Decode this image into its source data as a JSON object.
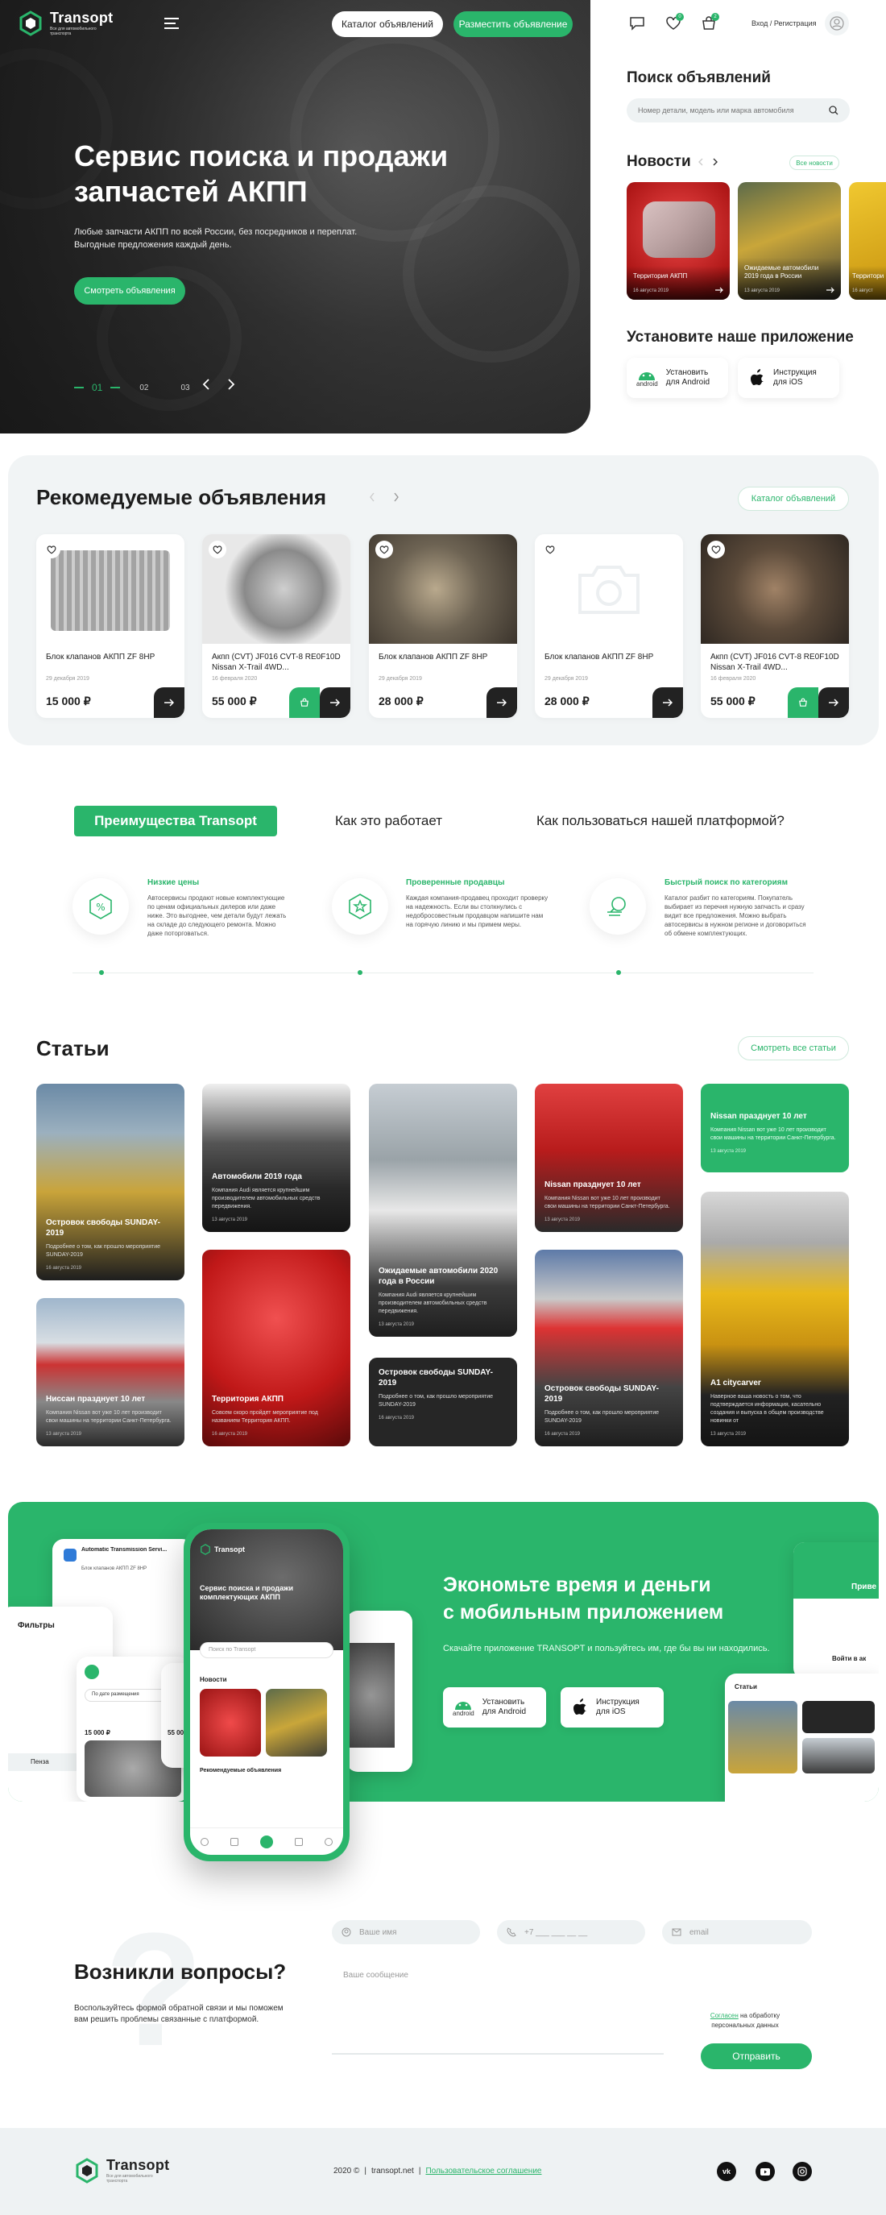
{
  "brand": {
    "name": "Transopt",
    "tagline": "Все для автомобильного транспорта"
  },
  "header": {
    "catalog_btn": "Каталог объявлений",
    "post_btn": "Разместить объявление",
    "cart_count": "2",
    "fav_count": "0",
    "login": "Вход / Регистрация"
  },
  "hero": {
    "title_line1": "Сервис поиска и продажи",
    "title_line2": "запчастей АКПП",
    "subtitle_line1": "Любые запчасти АКПП по всей России, без посредников и переплат.",
    "subtitle_line2": "Выгодные предложения каждый день.",
    "cta": "Смотреть объявления",
    "slides": [
      "01",
      "02",
      "03"
    ]
  },
  "search": {
    "title": "Поиск объявлений",
    "placeholder": "Номер детали, модель или марка автомобиля"
  },
  "news": {
    "title": "Новости",
    "all": "Все новости",
    "items": [
      {
        "title": "Территория АКПП",
        "date": "16 августа 2019"
      },
      {
        "title": "Ожидаемые автомобили 2019 года в России",
        "date": "13 августа 2019"
      },
      {
        "title": "Территори",
        "date": "16 август"
      }
    ]
  },
  "app": {
    "title": "Установите наше приложение",
    "android_line1": "Установить",
    "android_line2": "для Android",
    "android_badge": "android",
    "ios_line1": "Инструкция",
    "ios_line2": "для iOS"
  },
  "recommended": {
    "title": "Рекомедуемые объявления",
    "catalog": "Каталог объявлений",
    "items": [
      {
        "name": "Блок клапанов АКПП ZF 8HP",
        "date": "29 декабря 2019",
        "price": "15 000 ₽"
      },
      {
        "name": "Акпп (CVT) JF016 CVT-8 RE0F10D Nissan X-Trail 4WD...",
        "date": "16 февраля 2020",
        "price": "55 000 ₽"
      },
      {
        "name": "Блок клапанов АКПП ZF 8HP",
        "date": "29 декабря 2019",
        "price": "28 000 ₽"
      },
      {
        "name": "Блок клапанов АКПП ZF 8HP",
        "date": "29 декабря 2019",
        "price": "28 000 ₽"
      },
      {
        "name": "Акпп (CVT) JF016 CVT-8 RE0F10D Nissan X-Trail 4WD...",
        "date": "16 февраля 2020",
        "price": "55 000 ₽"
      }
    ]
  },
  "advantages": {
    "tabs": [
      "Преимущества Transopt",
      "Как это работает",
      "Как пользоваться нашей платформой?"
    ],
    "items": [
      {
        "title": "Низкие цены",
        "text": "Автосервисы продают новые комплектующие по ценам официальных дилеров или даже ниже. Это выгоднее, чем детали будут лежать на складе до следующего ремонта. Можно даже поторговаться."
      },
      {
        "title": "Проверенные продавцы",
        "text": "Каждая компания-продавец проходит проверку на надежность. Если вы столкнулись с недобросовестным продавцом напишите нам на горячую линию и мы примем меры."
      },
      {
        "title": "Быстрый поиск по категориям",
        "text": "Каталог разбит по категориям. Покупатель выбирает из перечня нужную запчасть и сразу видит все предложения. Можно выбрать автосервисы в нужном регионе и договориться об обмене комплектующих."
      }
    ]
  },
  "articles": {
    "title": "Статьи",
    "all": "Смотреть все статьи",
    "items": [
      {
        "title": "Островок свободы SUNDAY-2019",
        "text": "Подробнее о том, как прошло мероприятие SUNDAY-2019",
        "date": "16 августа 2019"
      },
      {
        "title": "Ниссан празднует 10 лет",
        "text": "Компания Nissan вот уже 10 лет производит свои машины на территории Санкт-Петербурга.",
        "date": "13 августа 2019"
      },
      {
        "title": "Автомобили 2019 года",
        "text": "Компания Audi является крупнейшим производителем автомобильных средств передвижения.",
        "date": "13 августа 2019"
      },
      {
        "title": "Территория АКПП",
        "text": "Совсем скоро пройдет мероприятие под названием Территория АКПП.",
        "date": "16 августа 2019"
      },
      {
        "title": "Ожидаемые автомобили 2020 года в России",
        "text": "Компания Audi является крупнейшим производителем автомобильных средств передвижения.",
        "date": "13 августа 2019"
      },
      {
        "title": "Островок свободы SUNDAY-2019",
        "text": "Подробнее о том, как прошло мероприятие SUNDAY-2019",
        "date": "16 августа 2019"
      },
      {
        "title": "Nissan празднует 10 лет",
        "text": "Компания Nissan вот уже 10 лет производит свои машины на территории Санкт-Петербурга.",
        "date": "13 августа 2019"
      },
      {
        "title": "Островок свободы SUNDAY-2019",
        "text": "Подробнее о том, как прошло мероприятие SUNDAY-2019",
        "date": "16 августа 2019"
      },
      {
        "title": "Nissan празднует 10 лет",
        "text": "Компания Nissan вот уже 10 лет производит свои машины на территории Санкт-Петербурга.",
        "date": "13 августа 2019"
      },
      {
        "title": "A1 citycarver",
        "text": "Наверное ваша новость о том, что подтверждается информация, касательно создания и выпуска в общем производстве новинки от",
        "date": "13 августа 2019"
      }
    ]
  },
  "promo": {
    "title_line1": "Экономьте время и деньги",
    "title_line2": "с мобильным приложением",
    "text": "Скачайте приложение TRANSOPT и пользуйтесь им, где бы вы ни находились.",
    "phone_title": "Сервис поиска и продажи комплектующих АКПП",
    "phone_search": "Поиск по Transopt",
    "phone_news": "Новости",
    "phone_rec": "Рекомендуемые объявления",
    "filters": "Фильтры",
    "filters_sort": "По дате размещения",
    "filters_price": "15 000 ₽",
    "filters_price2": "55 00",
    "filters_region": "Пенза",
    "listing": "Automatic Transmission Servi...",
    "listing_item": "Блок клапанов АКПП ZF 8HP",
    "articles_label": "Статьи",
    "right_hello": "Приве",
    "right_login": "Войти в ак"
  },
  "questions": {
    "title": "Возникли вопросы?",
    "text_line1": "Воспользуйтесь формой обратной связи и мы поможем",
    "text_line2": "вам решить проблемы связанные с платформой.",
    "name_ph": "Ваше имя",
    "phone_ph": "+7 ___ ___ __ __",
    "email_ph": "email",
    "message_ph": "Ваше сообщение",
    "consent_link": "Согласен",
    "consent_text": "на обработку персональных данных",
    "submit": "Отправить"
  },
  "footer": {
    "copyright": "2020 ©",
    "site": "transopt.net",
    "agreement": "Пользовательское соглашение"
  },
  "colors": {
    "accent": "#2ab56b",
    "dark": "#222222",
    "light_bg": "#f1f4f5"
  }
}
